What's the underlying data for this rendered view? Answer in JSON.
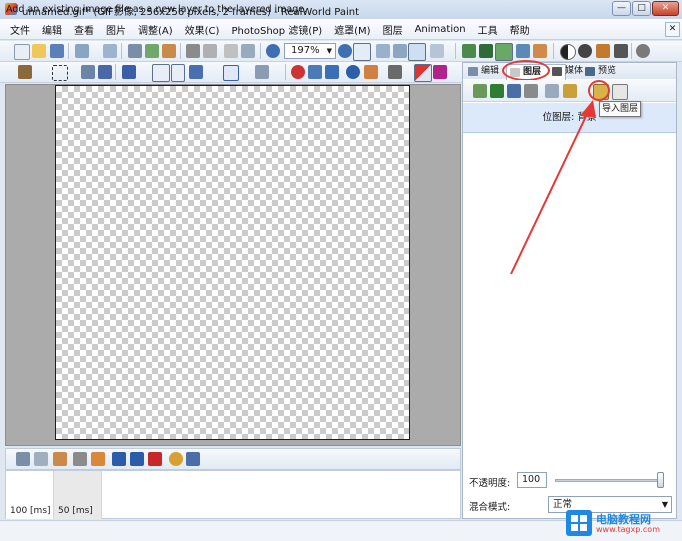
{
  "window": {
    "title": "unnamed.gif* (GIF影像, 256x256 pixels, 2 frames) - RealWorld Paint",
    "min_glyph": "—",
    "max_glyph": "□",
    "close_glyph": "✕",
    "mdi_close_glyph": "✕"
  },
  "menu": [
    "文件",
    "编辑",
    "查看",
    "图片",
    "调整(A)",
    "效果(C)",
    "PhotoShop 滤镜(P)",
    "遮罩(M)",
    "图层",
    "Animation",
    "工具",
    "帮助"
  ],
  "toolbar": {
    "zoom_value": "197%"
  },
  "frames": {
    "items": [
      {
        "label": "100 [ms]"
      },
      {
        "label": "50 [ms]"
      }
    ]
  },
  "status": {
    "text": "Add an existing image file as a new layer to the layered image."
  },
  "panel": {
    "tabs": [
      {
        "label": "编辑"
      },
      {
        "label": "图层"
      },
      {
        "label": "媒体"
      },
      {
        "label": "预览"
      }
    ],
    "active_tab": "图层",
    "layer_name": "位图层: 背景",
    "tooltip": "导入图层",
    "opacity_label": "不透明度:",
    "opacity_value": "100",
    "blend_label": "混合模式:",
    "blend_value": "正常"
  },
  "watermark": {
    "name": "电脑教程网",
    "url": "www.tagxp.com"
  },
  "colors": {
    "annotation": "#e53935",
    "accent": "#1e88e5"
  }
}
